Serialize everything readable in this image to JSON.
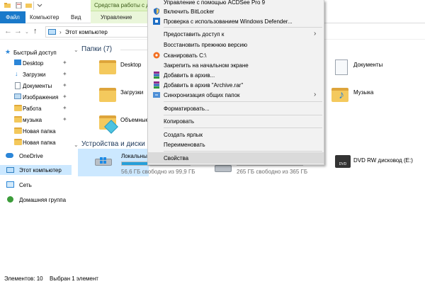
{
  "titlebar": {
    "context_tab": "Средства работы с диск"
  },
  "ribbon": {
    "tabs": [
      {
        "label": "Файл",
        "kind": "file"
      },
      {
        "label": "Компьютер",
        "kind": "normal"
      },
      {
        "label": "Вид",
        "kind": "normal"
      },
      {
        "label": "Управление",
        "kind": "manage"
      }
    ]
  },
  "address": {
    "path": "Этот компьютер"
  },
  "nav_pane": {
    "items": [
      {
        "label": "Быстрый доступ",
        "icon": "star-icon",
        "pinned": false
      },
      {
        "label": "Desktop",
        "icon": "folder-icon",
        "pinned": true
      },
      {
        "label": "Загрузки",
        "icon": "download-icon",
        "pinned": true
      },
      {
        "label": "Документы",
        "icon": "documents-icon",
        "pinned": true
      },
      {
        "label": "Изображения",
        "icon": "images-icon",
        "pinned": true
      },
      {
        "label": "Работа",
        "icon": "folder-icon",
        "pinned": true
      },
      {
        "label": "музыка",
        "icon": "folder-icon",
        "pinned": true
      },
      {
        "label": "Новая папка",
        "icon": "folder-icon",
        "pinned": false
      },
      {
        "label": "Новая папка",
        "icon": "folder-icon",
        "pinned": false
      },
      {
        "label": "OneDrive",
        "icon": "cloud-icon",
        "pinned": false
      },
      {
        "label": "Этот компьютер",
        "icon": "computer-icon",
        "pinned": false
      },
      {
        "label": "Сеть",
        "icon": "network-icon",
        "pinned": false
      },
      {
        "label": "Домашняя группа",
        "icon": "homegroup-icon",
        "pinned": false
      }
    ]
  },
  "content": {
    "folders_header": "Папки (7)",
    "folders": [
      "Desktop",
      "Загрузки",
      "Объемные",
      "Документы",
      "Музыка"
    ],
    "drives_header": "Устройства и диски (3)",
    "drives": [
      {
        "name": "Локальный",
        "free": "56,6 ГБ свободно из 99,9 ГБ",
        "used_fraction": 0.43
      },
      {
        "name": "",
        "free": "265 ГБ свободно из 365 ГБ",
        "used_fraction": 0.27
      },
      {
        "name": "DVD RW дисковод (E:)",
        "free": "",
        "used_fraction": 0
      }
    ]
  },
  "context_menu": {
    "items": [
      {
        "label": "Управление с помощью ACDSee Pro 9",
        "icon": "acdsee-icon",
        "submenu": false
      },
      {
        "label": "Включить BitLocker",
        "icon": "shield-icon",
        "submenu": false
      },
      {
        "label": "Проверка с использованием Windows Defender...",
        "icon": "defender-icon",
        "submenu": false
      },
      {
        "label": "Предоставить доступ к",
        "icon": "",
        "submenu": true
      },
      {
        "label": "Восстановить прежнюю версию",
        "icon": "",
        "submenu": false
      },
      {
        "label": "Сканировать C:\\",
        "icon": "avast-icon",
        "submenu": false
      },
      {
        "label": "Закрепить на начальном экране",
        "icon": "",
        "submenu": false
      },
      {
        "label": "Добавить в архив...",
        "icon": "winrar-icon",
        "submenu": false
      },
      {
        "label": "Добавить в архив \"Archive.rar\"",
        "icon": "winrar-icon",
        "submenu": false
      },
      {
        "label": "Синхронизация общих папок",
        "icon": "sync-icon",
        "submenu": true
      },
      {
        "label": "Форматировать...",
        "icon": "",
        "submenu": false
      },
      {
        "label": "Копировать",
        "icon": "",
        "submenu": false
      },
      {
        "label": "Создать ярлык",
        "icon": "",
        "submenu": false
      },
      {
        "label": "Переименовать",
        "icon": "",
        "submenu": false
      },
      {
        "label": "Свойства",
        "icon": "",
        "submenu": false
      }
    ]
  },
  "status": {
    "count": "Элементов: 10",
    "selected": "Выбран 1 элемент"
  },
  "colors": {
    "file_tab": "#1979ca",
    "selection": "#cce8ff",
    "context_tab": "#dff3c3",
    "progress": "#26a0da"
  }
}
